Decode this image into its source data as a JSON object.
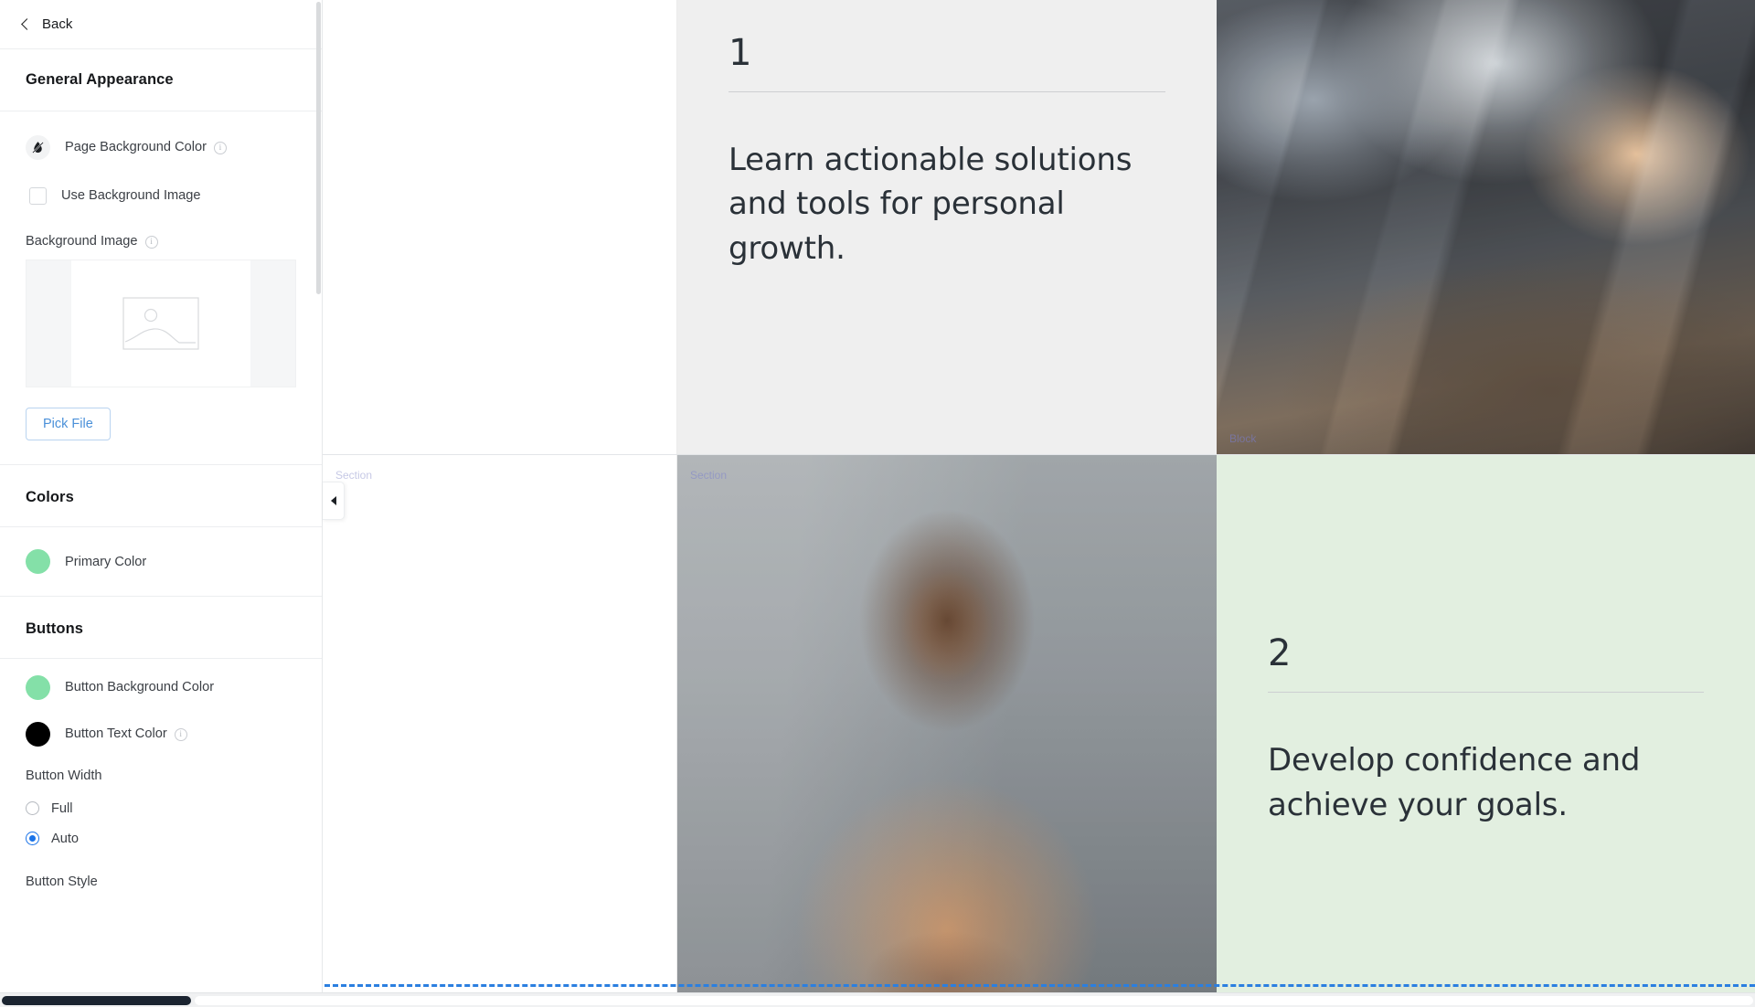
{
  "sidebar": {
    "back_label": "Back",
    "panel_title": "General Appearance",
    "rows": {
      "page_background_color": "Page Background Color",
      "use_background_image": "Use Background Image",
      "background_image_label": "Background Image",
      "pick_file_label": "Pick File"
    },
    "colors_section": {
      "heading": "Colors",
      "primary_color_label": "Primary Color",
      "primary_color_value": "#84e0a8"
    },
    "buttons_section": {
      "heading": "Buttons",
      "button_background_color_label": "Button Background Color",
      "button_background_color_value": "#84e0a8",
      "button_text_color_label": "Button Text Color",
      "button_text_color_value": "#000000",
      "button_width_label": "Button Width",
      "width_options": [
        {
          "label": "Full",
          "selected": false
        },
        {
          "label": "Auto",
          "selected": true
        }
      ],
      "button_style_label": "Button Style"
    },
    "icons": {
      "back": "chevron-left-icon",
      "no_color": "no-color-droplet-icon",
      "info": "i",
      "image_placeholder": "image-placeholder-icon"
    }
  },
  "canvas": {
    "overlay_labels": {
      "section": "Section",
      "block": "Block"
    },
    "cards": [
      {
        "number": "1",
        "heading": "Learn actionable solutions and tools for personal growth.",
        "background": "#efefef"
      },
      {
        "number": "2",
        "heading": "Develop confidence and achieve your goals.",
        "background": "#e2efe0"
      }
    ],
    "media": [
      {
        "name": "meeting-notes-photo",
        "alt": "People taking notes at a meeting table"
      },
      {
        "name": "woman-with-laptop-photo",
        "alt": "Woman with glasses holding a laptop"
      }
    ],
    "collapse_handle_icon": "chevron-left-icon"
  },
  "theme": {
    "accent_green": "#84e0a8",
    "link_blue": "#4a90d9",
    "radio_blue": "#1a73e8",
    "drop_indicator_blue": "#2b7fe0",
    "card_grey": "#efefef",
    "card_green": "#e2efe0",
    "text_dark": "#2a3138"
  }
}
